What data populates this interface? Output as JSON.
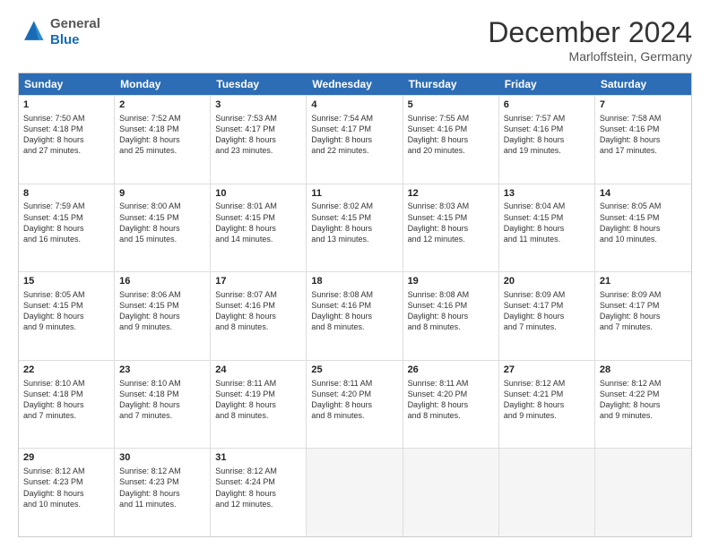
{
  "header": {
    "logo_line1": "General",
    "logo_line2": "Blue",
    "month_title": "December 2024",
    "location": "Marloffstein, Germany"
  },
  "days_of_week": [
    "Sunday",
    "Monday",
    "Tuesday",
    "Wednesday",
    "Thursday",
    "Friday",
    "Saturday"
  ],
  "weeks": [
    [
      {
        "day": 1,
        "lines": [
          "Sunrise: 7:50 AM",
          "Sunset: 4:18 PM",
          "Daylight: 8 hours",
          "and 27 minutes."
        ]
      },
      {
        "day": 2,
        "lines": [
          "Sunrise: 7:52 AM",
          "Sunset: 4:18 PM",
          "Daylight: 8 hours",
          "and 25 minutes."
        ]
      },
      {
        "day": 3,
        "lines": [
          "Sunrise: 7:53 AM",
          "Sunset: 4:17 PM",
          "Daylight: 8 hours",
          "and 23 minutes."
        ]
      },
      {
        "day": 4,
        "lines": [
          "Sunrise: 7:54 AM",
          "Sunset: 4:17 PM",
          "Daylight: 8 hours",
          "and 22 minutes."
        ]
      },
      {
        "day": 5,
        "lines": [
          "Sunrise: 7:55 AM",
          "Sunset: 4:16 PM",
          "Daylight: 8 hours",
          "and 20 minutes."
        ]
      },
      {
        "day": 6,
        "lines": [
          "Sunrise: 7:57 AM",
          "Sunset: 4:16 PM",
          "Daylight: 8 hours",
          "and 19 minutes."
        ]
      },
      {
        "day": 7,
        "lines": [
          "Sunrise: 7:58 AM",
          "Sunset: 4:16 PM",
          "Daylight: 8 hours",
          "and 17 minutes."
        ]
      }
    ],
    [
      {
        "day": 8,
        "lines": [
          "Sunrise: 7:59 AM",
          "Sunset: 4:15 PM",
          "Daylight: 8 hours",
          "and 16 minutes."
        ]
      },
      {
        "day": 9,
        "lines": [
          "Sunrise: 8:00 AM",
          "Sunset: 4:15 PM",
          "Daylight: 8 hours",
          "and 15 minutes."
        ]
      },
      {
        "day": 10,
        "lines": [
          "Sunrise: 8:01 AM",
          "Sunset: 4:15 PM",
          "Daylight: 8 hours",
          "and 14 minutes."
        ]
      },
      {
        "day": 11,
        "lines": [
          "Sunrise: 8:02 AM",
          "Sunset: 4:15 PM",
          "Daylight: 8 hours",
          "and 13 minutes."
        ]
      },
      {
        "day": 12,
        "lines": [
          "Sunrise: 8:03 AM",
          "Sunset: 4:15 PM",
          "Daylight: 8 hours",
          "and 12 minutes."
        ]
      },
      {
        "day": 13,
        "lines": [
          "Sunrise: 8:04 AM",
          "Sunset: 4:15 PM",
          "Daylight: 8 hours",
          "and 11 minutes."
        ]
      },
      {
        "day": 14,
        "lines": [
          "Sunrise: 8:05 AM",
          "Sunset: 4:15 PM",
          "Daylight: 8 hours",
          "and 10 minutes."
        ]
      }
    ],
    [
      {
        "day": 15,
        "lines": [
          "Sunrise: 8:05 AM",
          "Sunset: 4:15 PM",
          "Daylight: 8 hours",
          "and 9 minutes."
        ]
      },
      {
        "day": 16,
        "lines": [
          "Sunrise: 8:06 AM",
          "Sunset: 4:15 PM",
          "Daylight: 8 hours",
          "and 9 minutes."
        ]
      },
      {
        "day": 17,
        "lines": [
          "Sunrise: 8:07 AM",
          "Sunset: 4:16 PM",
          "Daylight: 8 hours",
          "and 8 minutes."
        ]
      },
      {
        "day": 18,
        "lines": [
          "Sunrise: 8:08 AM",
          "Sunset: 4:16 PM",
          "Daylight: 8 hours",
          "and 8 minutes."
        ]
      },
      {
        "day": 19,
        "lines": [
          "Sunrise: 8:08 AM",
          "Sunset: 4:16 PM",
          "Daylight: 8 hours",
          "and 8 minutes."
        ]
      },
      {
        "day": 20,
        "lines": [
          "Sunrise: 8:09 AM",
          "Sunset: 4:17 PM",
          "Daylight: 8 hours",
          "and 7 minutes."
        ]
      },
      {
        "day": 21,
        "lines": [
          "Sunrise: 8:09 AM",
          "Sunset: 4:17 PM",
          "Daylight: 8 hours",
          "and 7 minutes."
        ]
      }
    ],
    [
      {
        "day": 22,
        "lines": [
          "Sunrise: 8:10 AM",
          "Sunset: 4:18 PM",
          "Daylight: 8 hours",
          "and 7 minutes."
        ]
      },
      {
        "day": 23,
        "lines": [
          "Sunrise: 8:10 AM",
          "Sunset: 4:18 PM",
          "Daylight: 8 hours",
          "and 7 minutes."
        ]
      },
      {
        "day": 24,
        "lines": [
          "Sunrise: 8:11 AM",
          "Sunset: 4:19 PM",
          "Daylight: 8 hours",
          "and 8 minutes."
        ]
      },
      {
        "day": 25,
        "lines": [
          "Sunrise: 8:11 AM",
          "Sunset: 4:20 PM",
          "Daylight: 8 hours",
          "and 8 minutes."
        ]
      },
      {
        "day": 26,
        "lines": [
          "Sunrise: 8:11 AM",
          "Sunset: 4:20 PM",
          "Daylight: 8 hours",
          "and 8 minutes."
        ]
      },
      {
        "day": 27,
        "lines": [
          "Sunrise: 8:12 AM",
          "Sunset: 4:21 PM",
          "Daylight: 8 hours",
          "and 9 minutes."
        ]
      },
      {
        "day": 28,
        "lines": [
          "Sunrise: 8:12 AM",
          "Sunset: 4:22 PM",
          "Daylight: 8 hours",
          "and 9 minutes."
        ]
      }
    ],
    [
      {
        "day": 29,
        "lines": [
          "Sunrise: 8:12 AM",
          "Sunset: 4:23 PM",
          "Daylight: 8 hours",
          "and 10 minutes."
        ]
      },
      {
        "day": 30,
        "lines": [
          "Sunrise: 8:12 AM",
          "Sunset: 4:23 PM",
          "Daylight: 8 hours",
          "and 11 minutes."
        ]
      },
      {
        "day": 31,
        "lines": [
          "Sunrise: 8:12 AM",
          "Sunset: 4:24 PM",
          "Daylight: 8 hours",
          "and 12 minutes."
        ]
      },
      null,
      null,
      null,
      null
    ]
  ]
}
